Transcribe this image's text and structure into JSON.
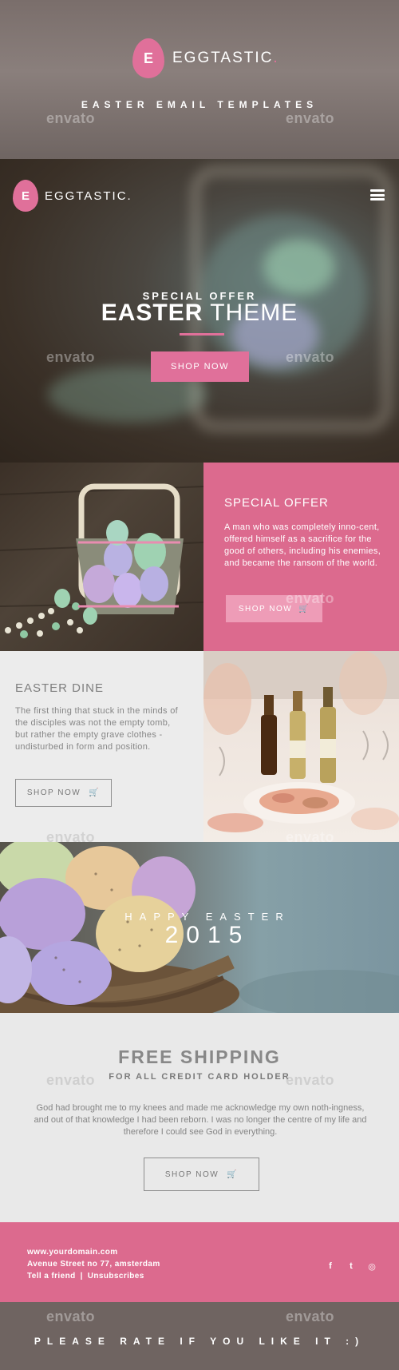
{
  "header": {
    "logo_letter": "E",
    "brand_name": "EGGTASTIC",
    "brand_dot": ".",
    "tagline": "EASTER EMAIL TEMPLATES"
  },
  "watermark": "envato",
  "hero": {
    "logo_letter": "E",
    "brand_name": "EGGTASTIC.",
    "kicker": "SPECIAL OFFER",
    "title_bold": "EASTER",
    "title_light": "THEME",
    "button_label": "SHOP NOW"
  },
  "special_offer": {
    "title": "SPECIAL OFFER",
    "text": "A man who was completely inno-cent, offered himself as a sacrifice for the good of others, including his enemies, and became the ransom of the world.",
    "button_label": "SHOP NOW",
    "button_icon": "cart-icon"
  },
  "easter_dine": {
    "title": "EASTER DINE",
    "text": "The first thing that stuck in the minds of the disciples was not the empty tomb, but rather the empty grave clothes - undisturbed in form and position.",
    "button_label": "SHOP NOW",
    "button_icon": "cart-icon"
  },
  "banner": {
    "kicker": "HAPPY EASTER",
    "year": "2015"
  },
  "shipping": {
    "title": "FREE SHIPPING",
    "subtitle": "FOR ALL CREDIT CARD HOLDER",
    "text": "God had brought me to my knees and made me acknowledge my own noth-ingness, and out of that knowledge I had been reborn. I was no longer the centre of my life and therefore I could see God in everything.",
    "button_label": "SHOP NOW",
    "button_icon": "cart-icon"
  },
  "footer": {
    "domain": "www.yourdomain.com",
    "address": "Avenue Street no 77, amsterdam",
    "tell_friend": "Tell a friend",
    "separator": "|",
    "unsubscribe": "Unsubscribes",
    "social_icons": [
      "facebook-icon",
      "twitter-icon",
      "instagram-icon"
    ],
    "social_glyphs": [
      "f",
      "t",
      "◎"
    ]
  },
  "rate": {
    "text": "PLEASE RATE IF YOU LIKE IT :)"
  },
  "colors": {
    "accent_pink": "#dc6a8e",
    "logo_pink": "#e0709a",
    "grey_brown": "#7a6e6b"
  }
}
